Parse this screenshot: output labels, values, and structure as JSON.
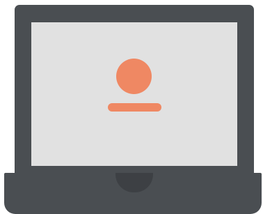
{
  "illustration": {
    "icon": "laptop-user-profile-icon",
    "colors": {
      "lid": "#4a4e52",
      "screen": "#e1e1e1",
      "avatar": "#ef8863",
      "base": "#4a4e52",
      "notch": "#3d4044",
      "background": "#ffffff"
    }
  }
}
